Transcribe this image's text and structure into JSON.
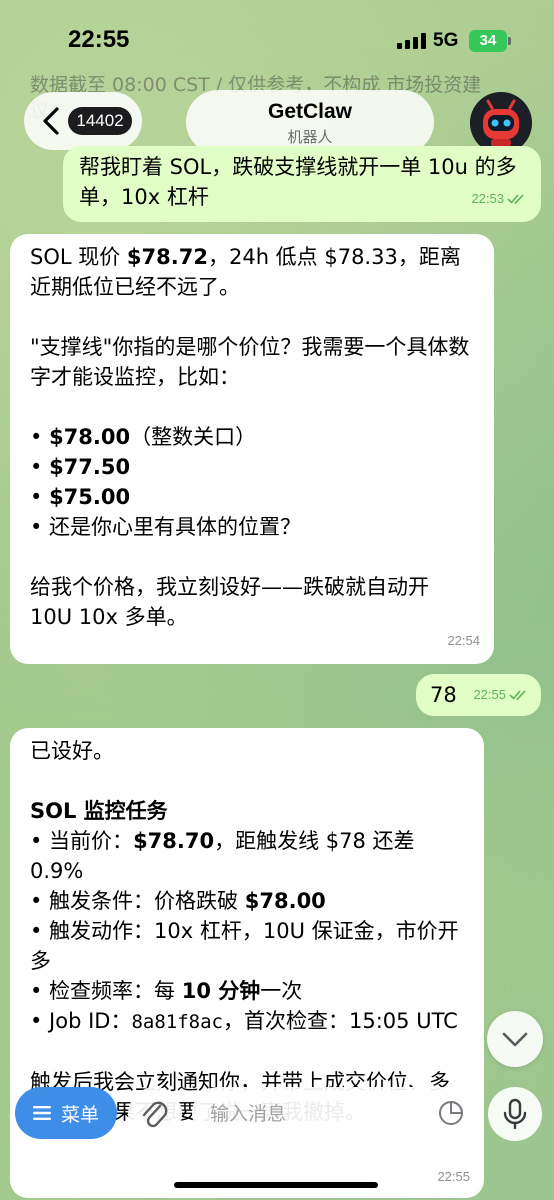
{
  "status": {
    "time": "22:55",
    "network": "5G",
    "battery": "34"
  },
  "ghost": {
    "text": "数据截至 08:00 CST / 仅供参考，不构成 市场投资建议。"
  },
  "header": {
    "back_badge": "14402",
    "title": "GetClaw",
    "subtitle": "机器人"
  },
  "messages": {
    "m1": {
      "text": "帮我盯着 SOL，跌破支撑线就开一单 10u 的多单，10x 杠杆",
      "time": "22:53"
    },
    "m2": {
      "l1a": "SOL 现价 ",
      "l1b": "$78.72",
      "l1c": "，24h 低点 $78.33，距离近期低位已经不远了。",
      "l2": "\"支撑线\"你指的是哪个价位？我需要一个具体数字才能设监控，比如：",
      "b1a": "• ",
      "b1b": "$78.00",
      "b1c": "（整数关口）",
      "b2a": "• ",
      "b2b": "$77.50",
      "b3a": "• ",
      "b3b": "$75.00",
      "b4": "• 还是你心里有具体的位置？",
      "l3": "给我个价格，我立刻设好——跌破就自动开 10U 10x 多单。",
      "time": "22:54"
    },
    "m3": {
      "text": "78",
      "time": "22:55"
    },
    "m4": {
      "l1": "已设好。",
      "heading": "SOL 监控任务",
      "i1a": "• 当前价：",
      "i1b": "$78.70",
      "i1c": "，距触发线 $78 还差 0.9%",
      "i2a": "• 触发条件：价格跌破 ",
      "i2b": "$78.00",
      "i3": "• 触发动作：10x 杠杆，10U 保证金，市价开多",
      "i4a": "• 检查频率：每 ",
      "i4b": "10 分钟",
      "i4c": "一次",
      "i5a": "• Job ID：",
      "i5b": "8a81f8ac",
      "i5c": "，首次检查：15:05 UTC",
      "tail": "触发后我会立刻通知你，并带上成交价位、多少张。如果不想要了说一声我撤掉。",
      "time": "22:55"
    }
  },
  "composer": {
    "menu_label": "菜单",
    "placeholder": "输入消息"
  },
  "colors": {
    "outgoing_bubble": "#e1fec6",
    "incoming_bubble": "#ffffff",
    "menu_button": "#3e8ee8",
    "battery": "#35c759"
  }
}
